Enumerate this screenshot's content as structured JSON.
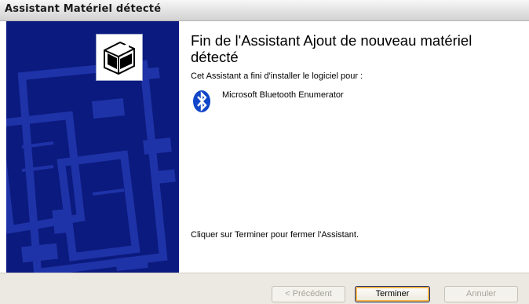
{
  "window": {
    "title": "Assistant Matériel détecté"
  },
  "content": {
    "heading": "Fin de l'Assistant Ajout de nouveau matériel détecté",
    "intro": "Cet Assistant a fini d'installer le logiciel pour :",
    "device": {
      "icon": "bluetooth-icon",
      "name": "Microsoft Bluetooth Enumerator"
    },
    "finish_text": "Cliquer sur Terminer pour fermer l'Assistant."
  },
  "buttons": {
    "previous": "< Précédent",
    "finish": "Terminer",
    "cancel": "Annuler"
  },
  "colors": {
    "wizard_panel": "#0b1a7e",
    "wizard_graphic": "#1f33a8",
    "bluetooth": "#1146c8"
  }
}
